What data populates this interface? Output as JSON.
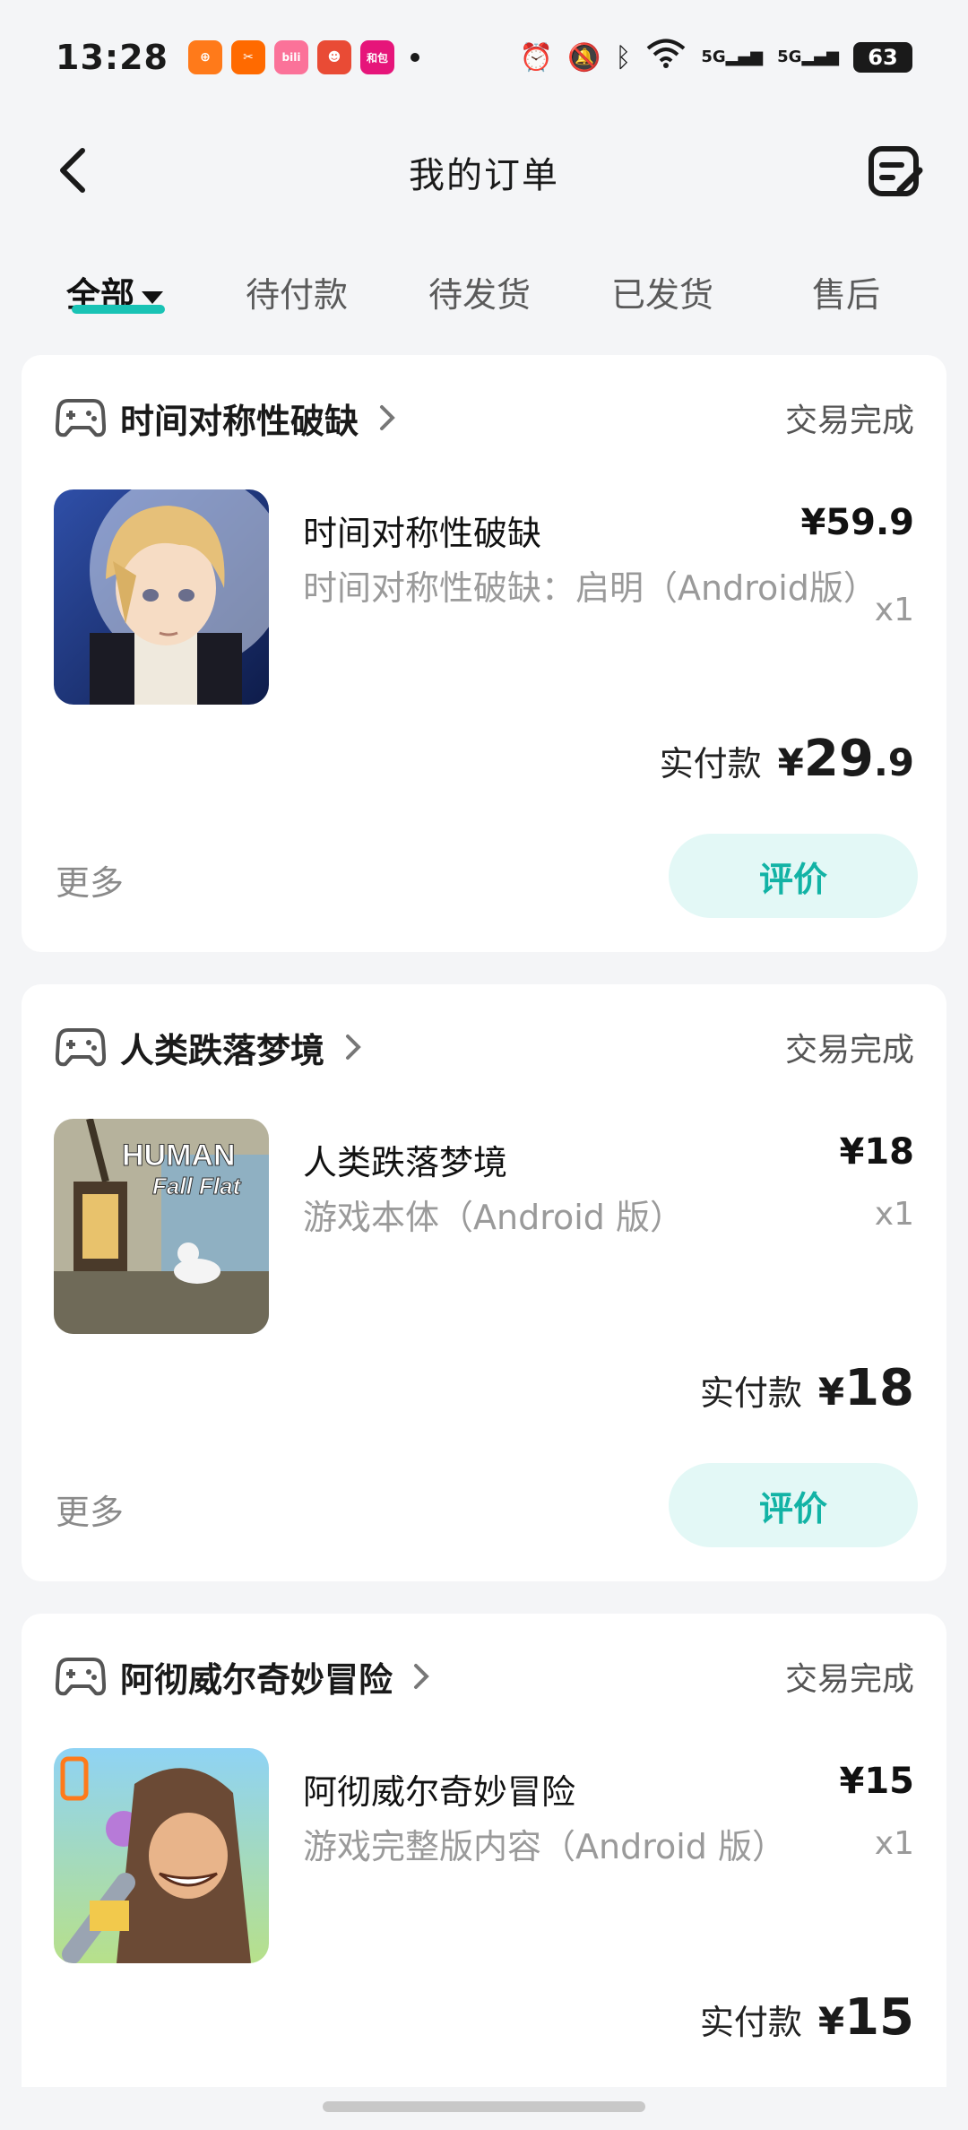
{
  "status_bar": {
    "time": "13:28",
    "battery": "63",
    "network": "5G",
    "app_icons": [
      {
        "name": "orange-app-icon",
        "color": "#ff7a1a",
        "text": "⊕"
      },
      {
        "name": "taobao-app-icon",
        "color": "#ff6a00",
        "text": "✂"
      },
      {
        "name": "bilibili-app-icon",
        "color": "#fb7299",
        "text": "bili"
      },
      {
        "name": "game-app-icon",
        "color": "#e94b35",
        "text": "☻"
      },
      {
        "name": "hebao-app-icon",
        "color": "#e6157a",
        "text": "和包"
      }
    ]
  },
  "header": {
    "title": "我的订单"
  },
  "tabs": [
    {
      "label": "全部",
      "active": true
    },
    {
      "label": "待付款"
    },
    {
      "label": "待发货"
    },
    {
      "label": "已发货"
    },
    {
      "label": "售后"
    }
  ],
  "orders": [
    {
      "shop": "时间对称性破缺",
      "status": "交易完成",
      "item_title": "时间对称性破缺",
      "price": "¥59.9",
      "subtitle": "时间对称性破缺：启明（Android版）",
      "qty": "x1",
      "paid_label": "实付款",
      "paid_yen": "¥",
      "paid_int": "29",
      "paid_dec": ".9",
      "more": "更多",
      "review": "评价"
    },
    {
      "shop": "人类跌落梦境",
      "status": "交易完成",
      "item_title": "人类跌落梦境",
      "price": "¥18",
      "subtitle": "游戏本体（Android 版）",
      "qty": "x1",
      "paid_label": "实付款",
      "paid_yen": "¥",
      "paid_int": "18",
      "paid_dec": "",
      "more": "更多",
      "review": "评价",
      "thumb_text": [
        "HUMAN",
        "Fall Flat"
      ]
    },
    {
      "shop": "阿彻威尔奇妙冒险",
      "status": "交易完成",
      "item_title": "阿彻威尔奇妙冒险",
      "price": "¥15",
      "subtitle": "游戏完整版内容（Android 版）",
      "qty": "x1",
      "paid_label": "实付款",
      "paid_yen": "¥",
      "paid_int": "15",
      "paid_dec": ""
    }
  ],
  "colors": {
    "accent": "#19c3b5",
    "review_bg": "#e3f8f6",
    "review_text": "#12b3a5"
  }
}
